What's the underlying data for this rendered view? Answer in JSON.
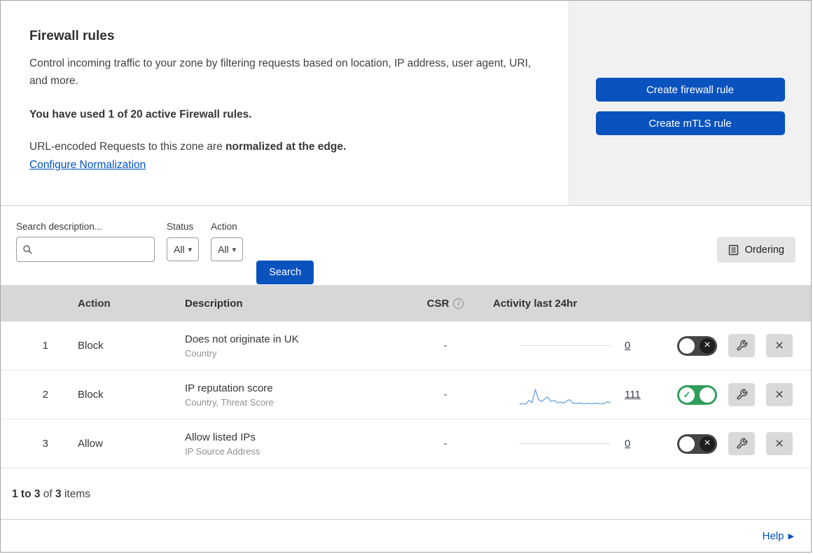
{
  "header": {
    "title": "Firewall rules",
    "description": "Control incoming traffic to your zone by filtering requests based on location, IP address, user agent, URI, and more.",
    "usage": "You have used 1 of 20 active Firewall rules.",
    "norm_prefix": "URL-encoded Requests to this zone are ",
    "norm_bold": "normalized at the edge.",
    "norm_link": "Configure Normalization",
    "create_firewall_button": "Create firewall rule",
    "create_mtls_button": "Create mTLS rule"
  },
  "filters": {
    "search_label": "Search description...",
    "status_label": "Status",
    "status_value": "All",
    "action_label": "Action",
    "action_value": "All",
    "search_button": "Search",
    "ordering_button": "Ordering"
  },
  "table": {
    "headers": {
      "action": "Action",
      "description": "Description",
      "csr": "CSR",
      "activity": "Activity last 24hr"
    },
    "rows": [
      {
        "num": "1",
        "action": "Block",
        "title": "Does not originate in UK",
        "subtitle": "Country",
        "csr": "-",
        "count": "0",
        "enabled": false
      },
      {
        "num": "2",
        "action": "Block",
        "title": "IP reputation score",
        "subtitle": "Country, Threat Score",
        "csr": "-",
        "count": "111",
        "enabled": true
      },
      {
        "num": "3",
        "action": "Allow",
        "title": "Allow listed IPs",
        "subtitle": "IP Source Address",
        "csr": "-",
        "count": "0",
        "enabled": false
      }
    ],
    "sparkline_points": [
      6,
      10,
      7,
      26,
      14,
      82,
      30,
      20,
      34,
      44,
      20,
      26,
      14,
      18,
      12,
      22,
      30,
      12,
      10,
      13,
      10,
      9,
      11,
      9,
      12,
      10,
      9,
      10,
      20,
      12
    ],
    "sparkline_color": "#7aaede"
  },
  "footer": {
    "range": "1 to 3",
    "of": "of",
    "total": "3",
    "items": "items",
    "help": "Help"
  },
  "colors": {
    "accent_blue": "#0a53be",
    "link_blue": "#0051c3",
    "toggle_on_green": "#2f9e5b"
  }
}
